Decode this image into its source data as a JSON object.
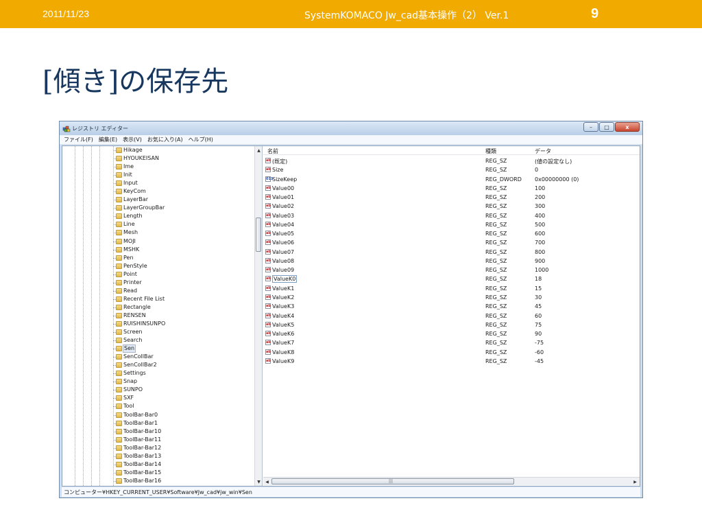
{
  "slide": {
    "date": "2011/11/23",
    "center_title": "SystemKOMACO Jw_cad基本操作（2） Ver.1",
    "page_number": "9",
    "heading": "[傾き]の保存先",
    "accent_color": "#f0aa00"
  },
  "window": {
    "title": "レジストリ エディター",
    "app_icon": "registry-icon",
    "buttons": {
      "minimize": "–",
      "maximize": "□",
      "close": "x"
    }
  },
  "menu": [
    "ファイル(F)",
    "編集(E)",
    "表示(V)",
    "お気に入り(A)",
    "ヘルプ(H)"
  ],
  "tree": {
    "selected": "Sen",
    "items": [
      "Hikage",
      "HYOUKEISAN",
      "Ime",
      "Init",
      "Input",
      "KeyCom",
      "LayerBar",
      "LayerGroupBar",
      "Length",
      "Line",
      "Mesh",
      "MOJI",
      "MSHK",
      "Pen",
      "PenStyle",
      "Point",
      "Printer",
      "Read",
      "Recent File List",
      "Rectangle",
      "RENSEN",
      "RUISHINSUNPO",
      "Screen",
      "Search",
      "Sen",
      "SenCollBar",
      "SenCollBar2",
      "Settings",
      "Snap",
      "SUNPO",
      "SXF",
      "Tool",
      "ToolBar-Bar0",
      "ToolBar-Bar1",
      "ToolBar-Bar10",
      "ToolBar-Bar11",
      "ToolBar-Bar12",
      "ToolBar-Bar13",
      "ToolBar-Bar14",
      "ToolBar-Bar15",
      "ToolBar-Bar16"
    ]
  },
  "list": {
    "columns": {
      "name": "名前",
      "type": "種類",
      "data": "データ"
    },
    "focused": "ValueK0",
    "rows": [
      {
        "name": "(既定)",
        "type": "REG_SZ",
        "data": "(値の設定なし)",
        "icon": "string-value-icon"
      },
      {
        "name": "Size",
        "type": "REG_SZ",
        "data": "0",
        "icon": "string-value-icon"
      },
      {
        "name": "SizeKeep",
        "type": "REG_DWORD",
        "data": "0x00000000 (0)",
        "icon": "dword-value-icon"
      },
      {
        "name": "Value00",
        "type": "REG_SZ",
        "data": "100",
        "icon": "string-value-icon"
      },
      {
        "name": "Value01",
        "type": "REG_SZ",
        "data": "200",
        "icon": "string-value-icon"
      },
      {
        "name": "Value02",
        "type": "REG_SZ",
        "data": "300",
        "icon": "string-value-icon"
      },
      {
        "name": "Value03",
        "type": "REG_SZ",
        "data": "400",
        "icon": "string-value-icon"
      },
      {
        "name": "Value04",
        "type": "REG_SZ",
        "data": "500",
        "icon": "string-value-icon"
      },
      {
        "name": "Value05",
        "type": "REG_SZ",
        "data": "600",
        "icon": "string-value-icon"
      },
      {
        "name": "Value06",
        "type": "REG_SZ",
        "data": "700",
        "icon": "string-value-icon"
      },
      {
        "name": "Value07",
        "type": "REG_SZ",
        "data": "800",
        "icon": "string-value-icon"
      },
      {
        "name": "Value08",
        "type": "REG_SZ",
        "data": "900",
        "icon": "string-value-icon"
      },
      {
        "name": "Value09",
        "type": "REG_SZ",
        "data": "1000",
        "icon": "string-value-icon"
      },
      {
        "name": "ValueK0",
        "type": "REG_SZ",
        "data": "18",
        "icon": "string-value-icon"
      },
      {
        "name": "ValueK1",
        "type": "REG_SZ",
        "data": "15",
        "icon": "string-value-icon"
      },
      {
        "name": "ValueK2",
        "type": "REG_SZ",
        "data": "30",
        "icon": "string-value-icon"
      },
      {
        "name": "ValueK3",
        "type": "REG_SZ",
        "data": "45",
        "icon": "string-value-icon"
      },
      {
        "name": "ValueK4",
        "type": "REG_SZ",
        "data": "60",
        "icon": "string-value-icon"
      },
      {
        "name": "ValueK5",
        "type": "REG_SZ",
        "data": "75",
        "icon": "string-value-icon"
      },
      {
        "name": "ValueK6",
        "type": "REG_SZ",
        "data": "90",
        "icon": "string-value-icon"
      },
      {
        "name": "ValueK7",
        "type": "REG_SZ",
        "data": "-75",
        "icon": "string-value-icon"
      },
      {
        "name": "ValueK8",
        "type": "REG_SZ",
        "data": "-60",
        "icon": "string-value-icon"
      },
      {
        "name": "ValueK9",
        "type": "REG_SZ",
        "data": "-45",
        "icon": "string-value-icon"
      }
    ]
  },
  "status": "コンピューター¥HKEY_CURRENT_USER¥Software¥Jw_cad¥jw_win¥Sen"
}
